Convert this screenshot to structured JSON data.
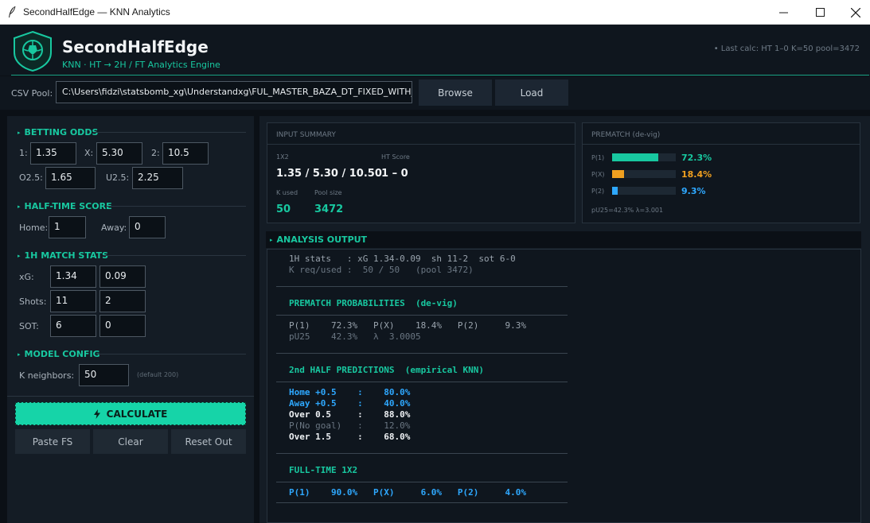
{
  "window": {
    "title": "SecondHalfEdge — KNN Analytics"
  },
  "header": {
    "title": "SecondHalfEdge",
    "subtitle": "KNN · HT → 2H / FT Analytics Engine",
    "last_calc": "• Last calc: HT 1–0  K=50  pool=3472"
  },
  "csv": {
    "label": "CSV Pool:",
    "path": "C:\\Users\\fidzi\\statsbomb_xg\\Understandxg\\FUL_MASTER_BAZA_DT_FIXED_WITH_",
    "browse_label": "Browse",
    "load_label": "Load"
  },
  "odds": {
    "title": "BETTING ODDS",
    "l1": "1:",
    "v1": "1.35",
    "lx": "X:",
    "vx": "5.30",
    "l2": "2:",
    "v2": "10.5",
    "lo25": "O2.5:",
    "vo25": "1.65",
    "lu25": "U2.5:",
    "vu25": "2.25"
  },
  "ht": {
    "title": "HALF-TIME SCORE",
    "home_label": "Home:",
    "home": "1",
    "away_label": "Away:",
    "away": "0"
  },
  "stats": {
    "title": "1H MATCH STATS",
    "xg_label": "xG:",
    "xg_home": "1.34",
    "xg_away": "0.09",
    "shots_label": "Shots:",
    "shots_home": "11",
    "shots_away": "2",
    "sot_label": "SOT:",
    "sot_home": "6",
    "sot_away": "0"
  },
  "model": {
    "title": "MODEL CONFIG",
    "k_label": "K neighbors:",
    "k": "50",
    "k_hint": "(default 200)"
  },
  "actions": {
    "calculate": "CALCULATE",
    "paste": "Paste FS",
    "clear": "Clear",
    "reset": "Reset Out"
  },
  "summary": {
    "title": "INPUT SUMMARY",
    "x12_label": "1X2",
    "x12": "1.35 / 5.30 / 10.50",
    "ht_label": "HT Score",
    "ht": "1 – 0",
    "k_label": "K used",
    "k": "50",
    "pool_label": "Pool size",
    "pool": "3472"
  },
  "prematch": {
    "title": "PREMATCH (de-vig)",
    "rows": [
      {
        "label": "P(1)",
        "value": "72.3%",
        "fraction": 0.723,
        "color": "#18c8a0"
      },
      {
        "label": "P(X)",
        "value": "18.4%",
        "fraction": 0.184,
        "color": "#f0a020"
      },
      {
        "label": "P(2)",
        "value": "9.3%",
        "fraction": 0.093,
        "color": "#2ea8ff"
      }
    ],
    "footer": "pU25=42.3%  λ=3.001"
  },
  "analysis": {
    "title": "ANALYSIS OUTPUT",
    "lines": {
      "stats": "1H stats   : xG 1.34-0.09  sh 11-2  sot 6-0",
      "kreq": "K req/used :  50 / 50   (pool 3472)",
      "pre_title": "PREMATCH PROBABILITIES  (de-vig)",
      "pre_1": "P(1)    72.3%   P(X)    18.4%   P(2)     9.3%",
      "pre_2": "pU25    42.3%   λ  3.0005",
      "sh_title": "2nd HALF PREDICTIONS  (empirical KNN)",
      "sh_1": "Home +0.5    :    80.0%",
      "sh_2": "Away +0.5    :    40.0%",
      "sh_3": "Over 0.5     :    88.0%",
      "sh_4": "P(No goal)   :    12.0%",
      "sh_5": "Over 1.5     :    68.0%",
      "ft_title": "FULL-TIME 1X2",
      "ft_1": "P(1)    90.0%   P(X)     6.0%   P(2)     4.0%"
    }
  }
}
